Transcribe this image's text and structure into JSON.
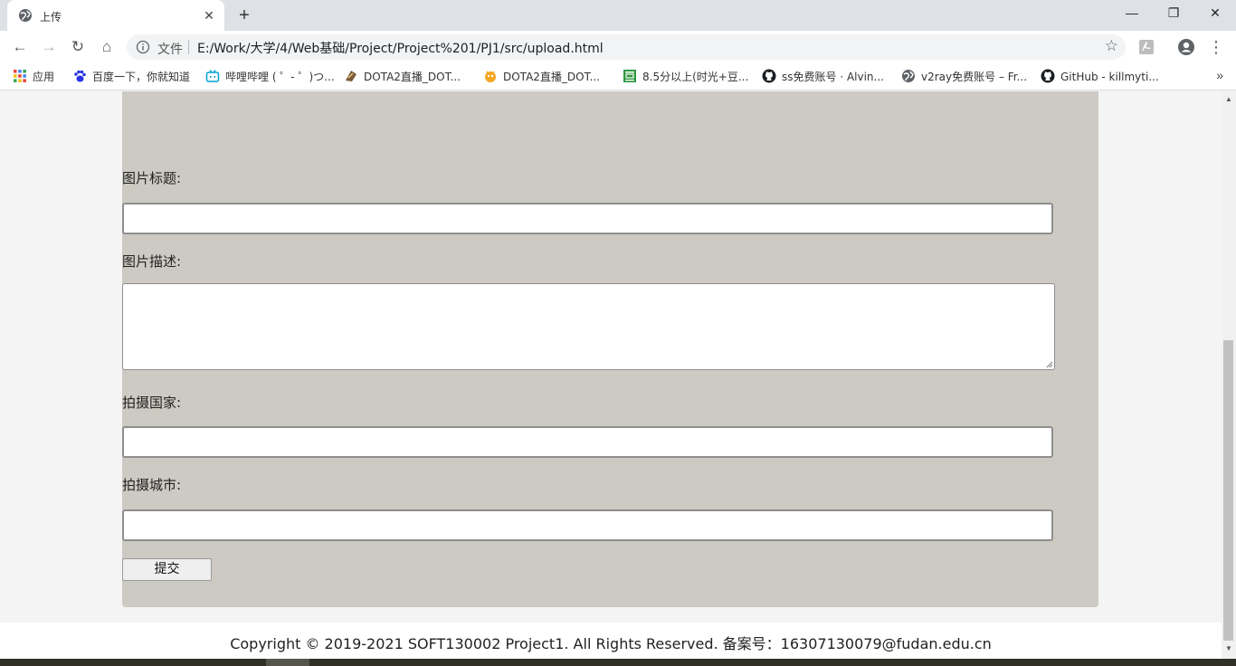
{
  "tab": {
    "title": "上传",
    "close_glyph": "✕",
    "favicon": "globe-icon"
  },
  "newtab_glyph": "+",
  "window": {
    "minimize": "—",
    "restore": "❐",
    "close": "✕"
  },
  "toolbar": {
    "back": "←",
    "forward": "→",
    "reload": "↻",
    "home": "⌂",
    "security_label": "文件",
    "url": "E:/Work/大学/4/Web基础/Project/Project%201/PJ1/src/upload.html",
    "star": "☆",
    "menu": "⋮"
  },
  "bookmarks": [
    {
      "label": "应用",
      "icon": "apps-grid-icon"
    },
    {
      "label": "百度一下，你就知道",
      "icon": "baidu-paw-icon"
    },
    {
      "label": "哔哩哔哩 ( ゜- ゜)つ...",
      "icon": "bilibili-tv-icon"
    },
    {
      "label": "DOTA2直播_DOT...",
      "icon": "dota-icon"
    },
    {
      "label": "DOTA2直播_DOT...",
      "icon": "douyu-icon"
    },
    {
      "label": "8.5分以上(时光+豆...",
      "icon": "douban-icon"
    },
    {
      "label": "ss免费账号 · Alvin...",
      "icon": "github-icon"
    },
    {
      "label": "v2ray免费账号 – Fr...",
      "icon": "globe-icon"
    },
    {
      "label": "GitHub - killmyti...",
      "icon": "github-icon"
    }
  ],
  "bookmarks_more": "»",
  "form": {
    "title_label": "图片标题:",
    "desc_label": "图片描述:",
    "country_label": "拍摄国家:",
    "city_label": "拍摄城市:",
    "submit_label": "提交"
  },
  "footer": {
    "text": "Copyright © 2019-2021 SOFT130002 Project1. All Rights Reserved. 备案号：16307130079@fudan.edu.cn"
  },
  "scrollbar": {
    "up": "▲",
    "down": "▼"
  }
}
